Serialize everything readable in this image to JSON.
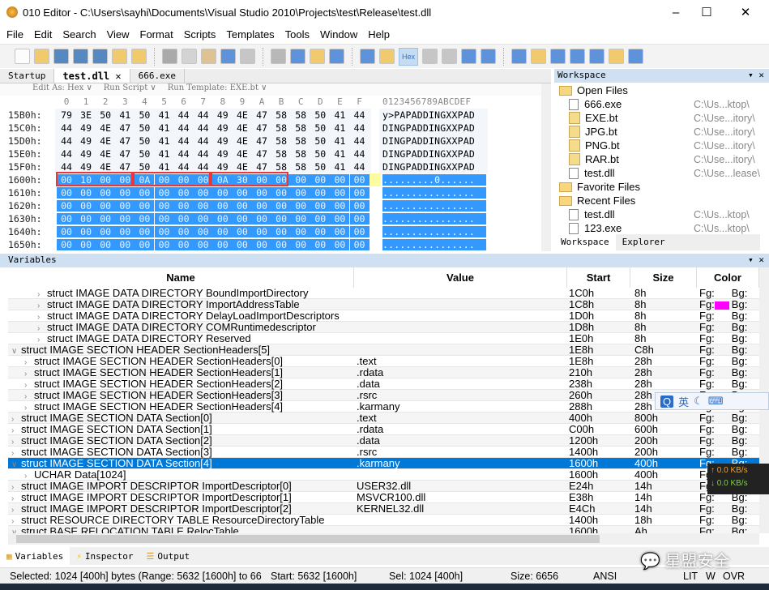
{
  "window": {
    "title": "010 Editor - C:\\Users\\sayhi\\Documents\\Visual Studio 2010\\Projects\\test\\Release\\test.dll",
    "minimize": "–",
    "maximize": "☐",
    "close": "✕"
  },
  "menu": [
    "File",
    "Edit",
    "Search",
    "View",
    "Format",
    "Scripts",
    "Templates",
    "Tools",
    "Window",
    "Help"
  ],
  "toolbar": {
    "hex_label": "Hex"
  },
  "tabs": [
    {
      "label": "Startup"
    },
    {
      "label": "test.dll ✕",
      "active": true
    },
    {
      "label": "666.exe"
    }
  ],
  "editbar": {
    "edit_as": "Edit As: Hex ∨",
    "run_script": "Run Script ∨",
    "run_template": "Run Template: EXE.bt ∨"
  },
  "hex": {
    "columns": [
      "0",
      "1",
      "2",
      "3",
      "4",
      "5",
      "6",
      "7",
      "8",
      "9",
      "A",
      "B",
      "C",
      "D",
      "E",
      "F"
    ],
    "ascii_header": "0123456789ABCDEF",
    "rows": [
      {
        "offset": "15B0h:",
        "bytes": [
          "79",
          "3E",
          "50",
          "41",
          "50",
          "41",
          "44",
          "44",
          "49",
          "4E",
          "47",
          "58",
          "58",
          "50",
          "41",
          "44"
        ],
        "ascii": "y>PAPADDINGXXPAD"
      },
      {
        "offset": "15C0h:",
        "bytes": [
          "44",
          "49",
          "4E",
          "47",
          "50",
          "41",
          "44",
          "44",
          "49",
          "4E",
          "47",
          "58",
          "58",
          "50",
          "41",
          "44"
        ],
        "ascii": "DINGPADDINGXXPAD"
      },
      {
        "offset": "15D0h:",
        "bytes": [
          "44",
          "49",
          "4E",
          "47",
          "50",
          "41",
          "44",
          "44",
          "49",
          "4E",
          "47",
          "58",
          "58",
          "50",
          "41",
          "44"
        ],
        "ascii": "DINGPADDINGXXPAD"
      },
      {
        "offset": "15E0h:",
        "bytes": [
          "44",
          "49",
          "4E",
          "47",
          "50",
          "41",
          "44",
          "44",
          "49",
          "4E",
          "47",
          "58",
          "58",
          "50",
          "41",
          "44"
        ],
        "ascii": "DINGPADDINGXXPAD"
      },
      {
        "offset": "15F0h:",
        "bytes": [
          "44",
          "49",
          "4E",
          "47",
          "50",
          "41",
          "44",
          "44",
          "49",
          "4E",
          "47",
          "58",
          "58",
          "50",
          "41",
          "44"
        ],
        "ascii": "DINGPADDINGXXPAD"
      },
      {
        "offset": "1600h:",
        "bytes": [
          "00",
          "10",
          "00",
          "00",
          "0A",
          "00",
          "00",
          "00",
          "0A",
          "30",
          "00",
          "00",
          "00",
          "00",
          "00",
          "00"
        ],
        "ascii": ".........0......",
        "selected": true
      },
      {
        "offset": "1610h:",
        "bytes": [
          "00",
          "00",
          "00",
          "00",
          "00",
          "00",
          "00",
          "00",
          "00",
          "00",
          "00",
          "00",
          "00",
          "00",
          "00",
          "00"
        ],
        "ascii": "................",
        "selected": true
      },
      {
        "offset": "1620h:",
        "bytes": [
          "00",
          "00",
          "00",
          "00",
          "00",
          "00",
          "00",
          "00",
          "00",
          "00",
          "00",
          "00",
          "00",
          "00",
          "00",
          "00"
        ],
        "ascii": "................",
        "selected": true
      },
      {
        "offset": "1630h:",
        "bytes": [
          "00",
          "00",
          "00",
          "00",
          "00",
          "00",
          "00",
          "00",
          "00",
          "00",
          "00",
          "00",
          "00",
          "00",
          "00",
          "00"
        ],
        "ascii": "................",
        "selected": true
      },
      {
        "offset": "1640h:",
        "bytes": [
          "00",
          "00",
          "00",
          "00",
          "00",
          "00",
          "00",
          "00",
          "00",
          "00",
          "00",
          "00",
          "00",
          "00",
          "00",
          "00"
        ],
        "ascii": "................",
        "selected": true
      },
      {
        "offset": "1650h:",
        "bytes": [
          "00",
          "00",
          "00",
          "00",
          "00",
          "00",
          "00",
          "00",
          "00",
          "00",
          "00",
          "00",
          "00",
          "00",
          "00",
          "00"
        ],
        "ascii": "................",
        "selected": true
      }
    ]
  },
  "workspace": {
    "title": "Workspace",
    "items": [
      {
        "label": "Open Files",
        "type": "folder"
      },
      {
        "label": "666.exe",
        "path": "C:\\Us...ktop\\",
        "type": "file"
      },
      {
        "label": "EXE.bt",
        "path": "C:\\Use...itory\\",
        "type": "bt"
      },
      {
        "label": "JPG.bt",
        "path": "C:\\Use...itory\\",
        "type": "bt"
      },
      {
        "label": "PNG.bt",
        "path": "C:\\Use...itory\\",
        "type": "bt"
      },
      {
        "label": "RAR.bt",
        "path": "C:\\Use...itory\\",
        "type": "bt"
      },
      {
        "label": "test.dll",
        "path": "C:\\Use...lease\\",
        "type": "file"
      },
      {
        "label": "Favorite Files",
        "type": "folder"
      },
      {
        "label": "Recent Files",
        "type": "folder"
      },
      {
        "label": "test.dll",
        "path": "C:\\Us...ktop\\",
        "type": "file"
      },
      {
        "label": "123.exe",
        "path": "C:\\Us...ktop\\",
        "type": "file"
      }
    ],
    "tabs": [
      "Workspace",
      "Explorer"
    ]
  },
  "variables": {
    "title": "Variables",
    "columns": [
      "Name",
      "Value",
      "Start",
      "Size",
      "Color"
    ],
    "rows": [
      {
        "indent": 2,
        "caret": "›",
        "name": "struct IMAGE DATA DIRECTORY BoundImportDirectory",
        "value": "",
        "start": "1C0h",
        "size": "8h",
        "fg": "Fg:",
        "bg": "Bg:"
      },
      {
        "indent": 2,
        "caret": "›",
        "name": "struct IMAGE DATA DIRECTORY ImportAddressTable",
        "value": "",
        "start": "1C8h",
        "size": "8h",
        "fg": "Fg:",
        "bg": "Bg:",
        "swatch": "#ff00ff"
      },
      {
        "indent": 2,
        "caret": "›",
        "name": "struct IMAGE DATA DIRECTORY DelayLoadImportDescriptors",
        "value": "",
        "start": "1D0h",
        "size": "8h",
        "fg": "Fg:",
        "bg": "Bg:"
      },
      {
        "indent": 2,
        "caret": "›",
        "name": "struct IMAGE DATA DIRECTORY COMRuntimedescriptor",
        "value": "",
        "start": "1D8h",
        "size": "8h",
        "fg": "Fg:",
        "bg": "Bg:"
      },
      {
        "indent": 2,
        "caret": "›",
        "name": "struct IMAGE DATA DIRECTORY Reserved",
        "value": "",
        "start": "1E0h",
        "size": "8h",
        "fg": "Fg:",
        "bg": "Bg:"
      },
      {
        "indent": 0,
        "caret": "∨",
        "name": "struct IMAGE SECTION HEADER SectionHeaders[5]",
        "value": "",
        "start": "1E8h",
        "size": "C8h",
        "fg": "Fg:",
        "bg": "Bg:"
      },
      {
        "indent": 1,
        "caret": "›",
        "name": "struct IMAGE SECTION HEADER SectionHeaders[0]",
        "value": ".text",
        "start": "1E8h",
        "size": "28h",
        "fg": "Fg:",
        "bg": "Bg:"
      },
      {
        "indent": 1,
        "caret": "›",
        "name": "struct IMAGE SECTION HEADER SectionHeaders[1]",
        "value": ".rdata",
        "start": "210h",
        "size": "28h",
        "fg": "Fg:",
        "bg": "Bg:"
      },
      {
        "indent": 1,
        "caret": "›",
        "name": "struct IMAGE SECTION HEADER SectionHeaders[2]",
        "value": ".data",
        "start": "238h",
        "size": "28h",
        "fg": "Fg:",
        "bg": "Bg:"
      },
      {
        "indent": 1,
        "caret": "›",
        "name": "struct IMAGE SECTION HEADER SectionHeaders[3]",
        "value": ".rsrc",
        "start": "260h",
        "size": "28h",
        "fg": "Fg:",
        "bg": "Bg:"
      },
      {
        "indent": 1,
        "caret": "›",
        "name": "struct IMAGE SECTION HEADER SectionHeaders[4]",
        "value": ".karmany",
        "start": "288h",
        "size": "28h",
        "fg": "Fg:",
        "bg": "Bg:"
      },
      {
        "indent": 0,
        "caret": "›",
        "name": "struct IMAGE SECTION DATA Section[0]",
        "value": ".text",
        "start": "400h",
        "size": "800h",
        "fg": "Fg:",
        "bg": "Bg:"
      },
      {
        "indent": 0,
        "caret": "›",
        "name": "struct IMAGE SECTION DATA Section[1]",
        "value": ".rdata",
        "start": "C00h",
        "size": "600h",
        "fg": "Fg:",
        "bg": "Bg:"
      },
      {
        "indent": 0,
        "caret": "›",
        "name": "struct IMAGE SECTION DATA Section[2]",
        "value": ".data",
        "start": "1200h",
        "size": "200h",
        "fg": "Fg:",
        "bg": "Bg:"
      },
      {
        "indent": 0,
        "caret": "›",
        "name": "struct IMAGE SECTION DATA Section[3]",
        "value": ".rsrc",
        "start": "1400h",
        "size": "200h",
        "fg": "Fg:",
        "bg": "Bg:"
      },
      {
        "indent": 0,
        "caret": "∨",
        "name": "struct IMAGE SECTION DATA Section[4]",
        "value": ".karmany",
        "start": "1600h",
        "size": "400h",
        "fg": "Fg:",
        "bg": "Bg:",
        "selected": true
      },
      {
        "indent": 1,
        "caret": "›",
        "name": "UCHAR Data[1024]",
        "value": "",
        "start": "1600h",
        "size": "400h",
        "fg": "Fg:",
        "bg": "Bg:"
      },
      {
        "indent": 0,
        "caret": "›",
        "name": "struct IMAGE IMPORT DESCRIPTOR ImportDescriptor[0]",
        "value": "USER32.dll",
        "start": "E24h",
        "size": "14h",
        "fg": "Fg:",
        "bg": "Bg:"
      },
      {
        "indent": 0,
        "caret": "›",
        "name": "struct IMAGE IMPORT DESCRIPTOR ImportDescriptor[1]",
        "value": "MSVCR100.dll",
        "start": "E38h",
        "size": "14h",
        "fg": "Fg:",
        "bg": "Bg:"
      },
      {
        "indent": 0,
        "caret": "›",
        "name": "struct IMAGE IMPORT DESCRIPTOR ImportDescriptor[2]",
        "value": "KERNEL32.dll",
        "start": "E4Ch",
        "size": "14h",
        "fg": "Fg:",
        "bg": "Bg:"
      },
      {
        "indent": 0,
        "caret": "›",
        "name": "struct RESOURCE DIRECTORY TABLE ResourceDirectoryTable",
        "value": "",
        "start": "1400h",
        "size": "18h",
        "fg": "Fg:",
        "bg": "Bg:"
      },
      {
        "indent": 0,
        "caret": "∨",
        "name": "struct BASE RELOCATION TABLE RelocTable",
        "value": "",
        "start": "1600h",
        "size": "Ah",
        "fg": "Fg:",
        "bg": "Bg:"
      }
    ]
  },
  "bottom_tabs": [
    "Variables",
    "Inspector",
    "Output"
  ],
  "status": {
    "selected": "Selected: 1024 [400h] bytes (Range: 5632 [1600h] to 66",
    "start": "Start: 5632 [1600h]",
    "sel": "Sel: 1024 [400h]",
    "size": "Size: 6656",
    "encoding": "ANSI",
    "lit": "LIT",
    "w": "W",
    "ovr": "OVR"
  },
  "overlay": {
    "ime": "英",
    "upload": "↑ 0.0 KB/s",
    "download": "↓ 0.0 KB/s",
    "watermark": "星盟安全"
  },
  "colors": {
    "selection": "#3399ff",
    "highlight_box": "#e8363d",
    "row_selected": "#0078d7",
    "panel_header": "#cfe0f3"
  }
}
